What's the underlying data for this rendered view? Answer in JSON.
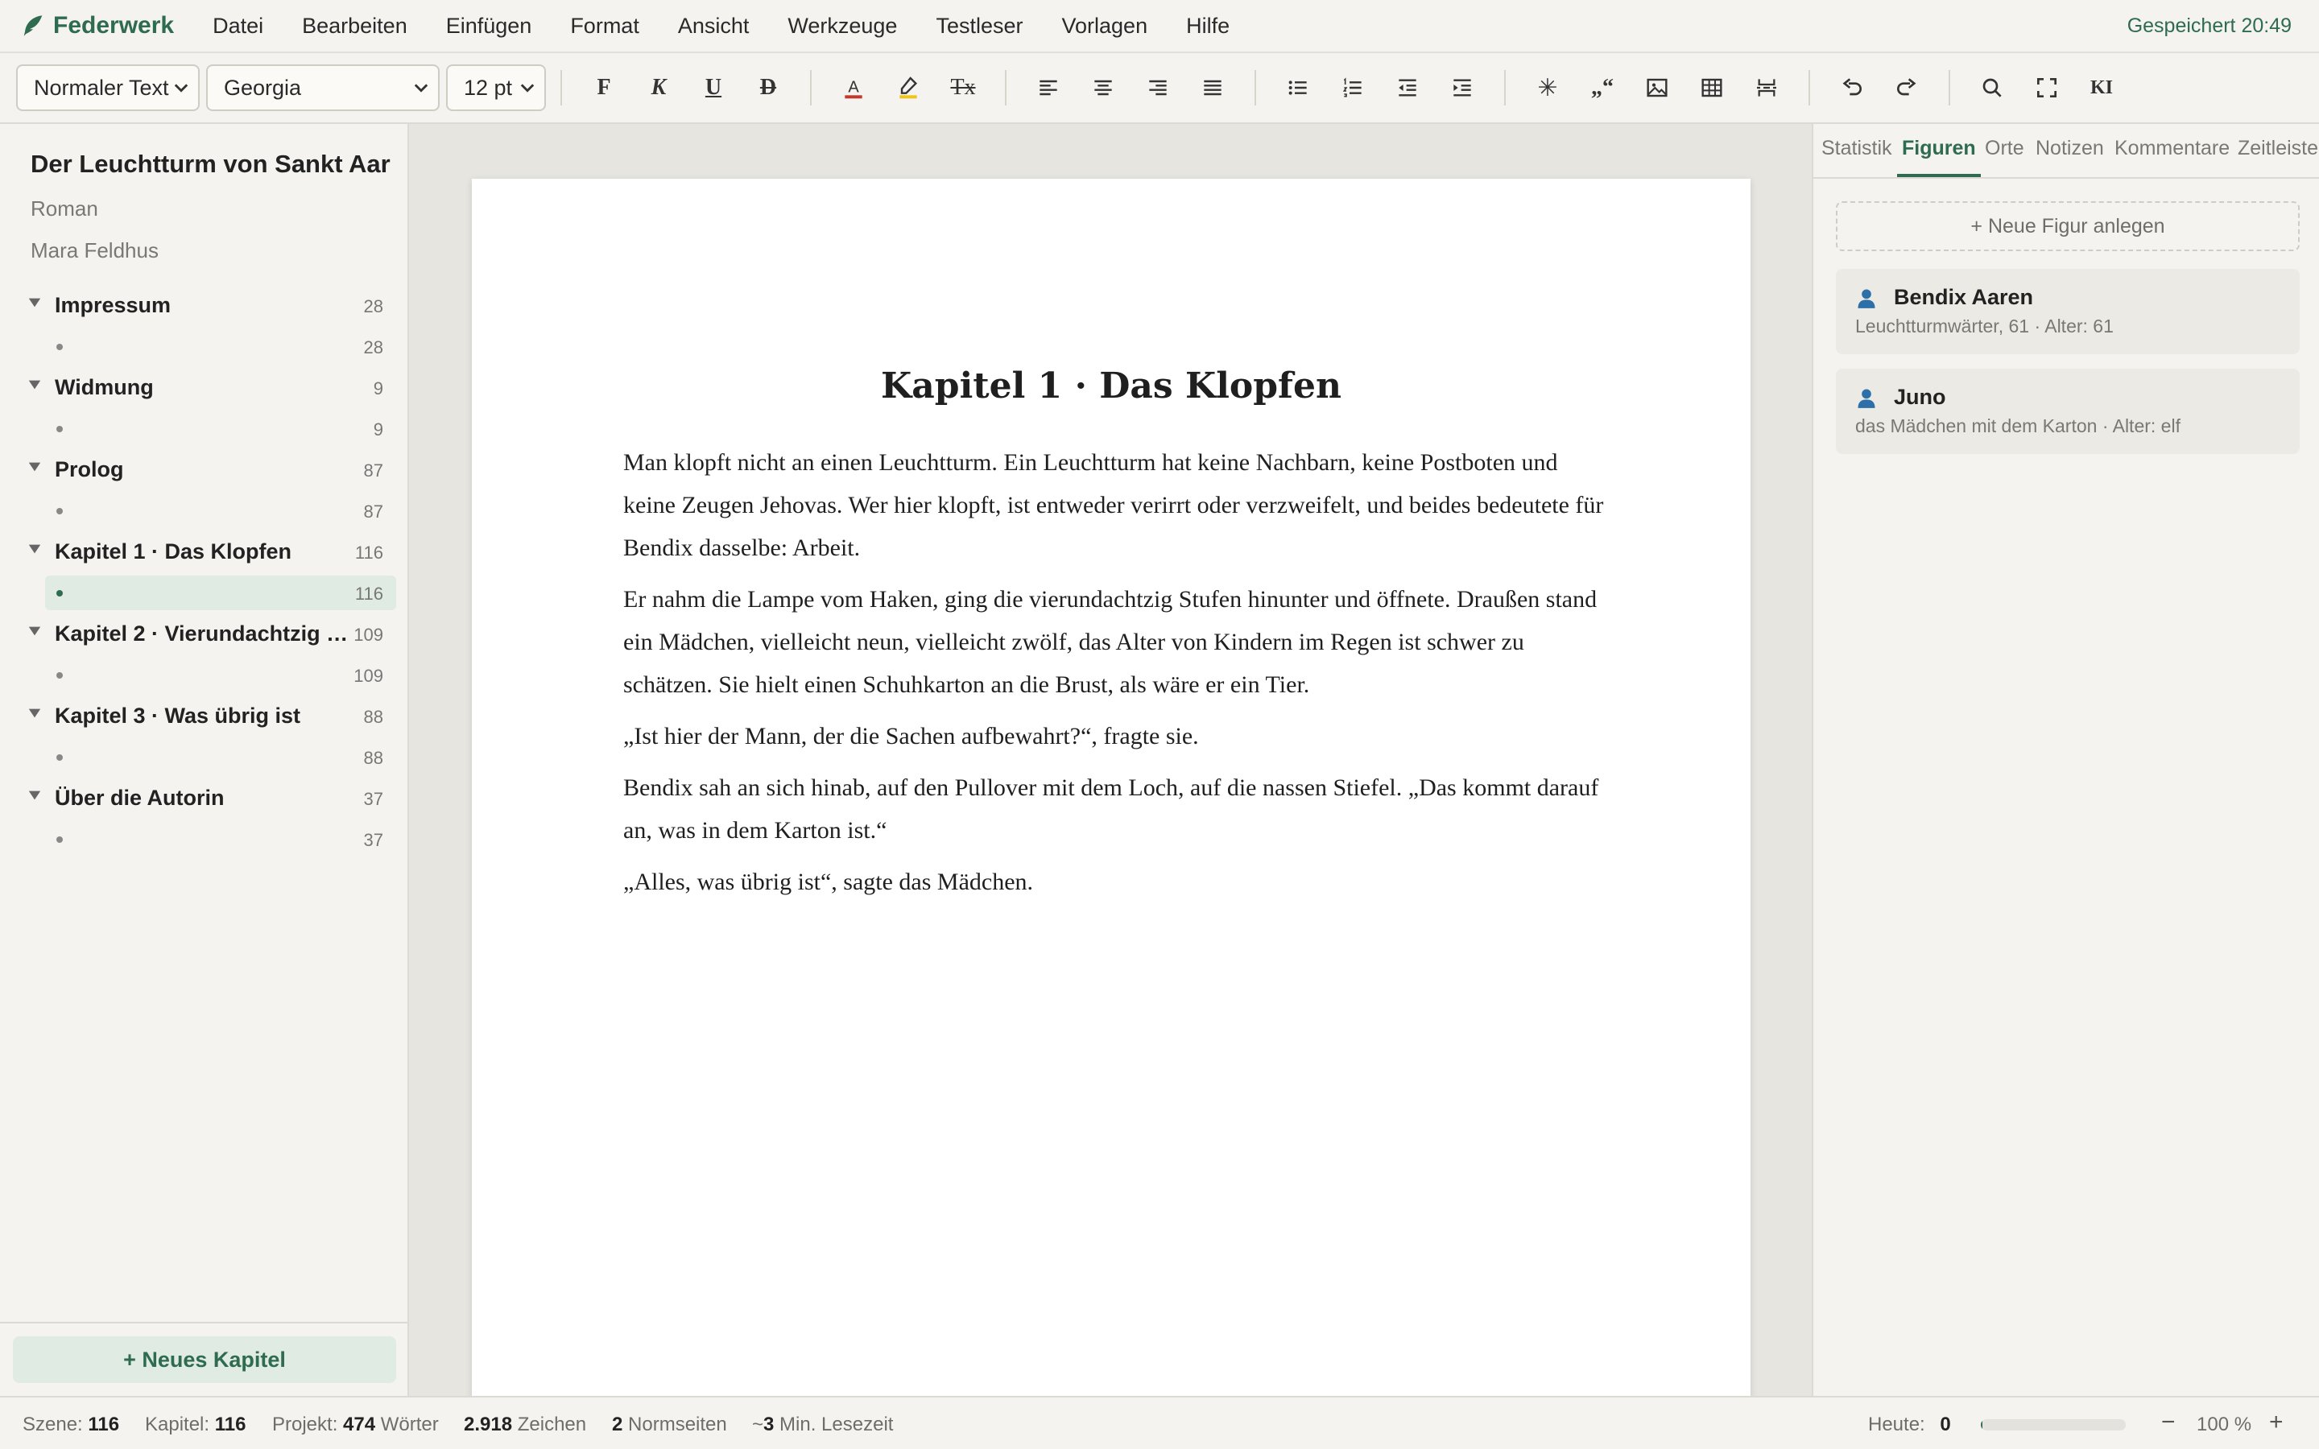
{
  "app": {
    "name": "Federwerk",
    "saved_status": "Gespeichert 20:49"
  },
  "menu": [
    "Datei",
    "Bearbeiten",
    "Einfügen",
    "Format",
    "Ansicht",
    "Werkzeuge",
    "Testleser",
    "Vorlagen",
    "Hilfe"
  ],
  "toolbar": {
    "style_select": "Normaler Text",
    "font_select": "Georgia",
    "size_select": "12 pt",
    "bold_label": "F",
    "italic_label": "K",
    "underline_label": "U",
    "strike_label": "D",
    "textcolor_label": "A",
    "clearformat_label": "Tx",
    "scenebreak_label": "✳",
    "quote_label": "„“",
    "ai_label": "KI",
    "textcolor_accent": "#c0392b",
    "highlight_accent": "#f0c419"
  },
  "project": {
    "title": "Der Leuchtturm von Sankt Aar",
    "genre": "Roman",
    "author": "Mara Feldhus"
  },
  "chapters": [
    {
      "title": "Impressum",
      "count": "28",
      "scene_count": "28",
      "active": false
    },
    {
      "title": "Widmung",
      "count": "9",
      "scene_count": "9",
      "active": false
    },
    {
      "title": "Prolog",
      "count": "87",
      "scene_count": "87",
      "active": false
    },
    {
      "title": "Kapitel 1 · Das Klopfen",
      "count": "116",
      "scene_count": "116",
      "active": true
    },
    {
      "title": "Kapitel 2 · Vierundachtzig …",
      "count": "109",
      "scene_count": "109",
      "active": false
    },
    {
      "title": "Kapitel 3 · Was übrig ist",
      "count": "88",
      "scene_count": "88",
      "active": false
    },
    {
      "title": "Über die Autorin",
      "count": "37",
      "scene_count": "37",
      "active": false
    }
  ],
  "sidebar": {
    "new_chapter_label": "+ Neues Kapitel"
  },
  "document": {
    "heading": "Kapitel 1 · Das Klopfen",
    "paragraphs": [
      "Man klopft nicht an einen Leuchtturm. Ein Leuchtturm hat keine Nachbarn, keine Postboten und keine Zeugen Jehovas. Wer hier klopft, ist entweder verirrt oder verzweifelt, und beides bedeutete für Bendix dasselbe: Arbeit.",
      "Er nahm die Lampe vom Haken, ging die vierundachtzig Stufen hinunter und öffnete. Draußen stand ein Mädchen, vielleicht neun, vielleicht zwölf, das Alter von Kindern im Regen ist schwer zu schätzen. Sie hielt einen Schuhkarton an die Brust, als wäre er ein Tier.",
      "„Ist hier der Mann, der die Sachen aufbewahrt?“, fragte sie.",
      "Bendix sah an sich hinab, auf den Pullover mit dem Loch, auf die nassen Stiefel. „Das kommt darauf an, was in dem Karton ist.“",
      "„Alles, was übrig ist“, sagte das Mädchen."
    ]
  },
  "panel": {
    "tabs": [
      "Statistik",
      "Figuren",
      "Orte",
      "Notizen",
      "Kommentare",
      "Zeitleiste"
    ],
    "active_tab": "Figuren",
    "new_figure_label": "+ Neue Figur anlegen",
    "figures": [
      {
        "name": "Bendix Aaren",
        "desc": "Leuchtturmwärter, 61 · Alter: 61"
      },
      {
        "name": "Juno",
        "desc": "das Mädchen mit dem Karton · Alter: elf"
      }
    ]
  },
  "status": {
    "scene_label": "Szene:",
    "scene_value": "116",
    "chapter_label": "Kapitel:",
    "chapter_value": "116",
    "project_label": "Projekt:",
    "project_value": "474",
    "project_unit": "Wörter",
    "chars_value": "2.918",
    "chars_unit": "Zeichen",
    "pages_value": "2",
    "pages_unit": "Normseiten",
    "read_prefix": "~",
    "read_value": "3",
    "read_unit": "Min. Lesezeit",
    "today_label": "Heute:",
    "today_value": "0",
    "today_progress": 0.01,
    "zoom_minus": "−",
    "zoom_value": "100 %",
    "zoom_plus": "+"
  },
  "colors": {
    "accent": "#2e6b4f",
    "accent_soft": "#e0ebe3"
  }
}
